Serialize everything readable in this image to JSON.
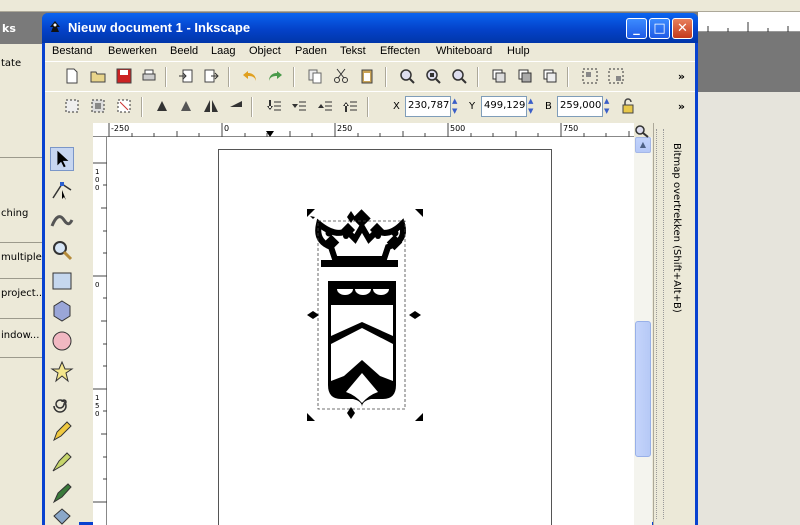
{
  "window": {
    "title": "Nieuw document 1 - Inkscape",
    "minimize_label": "_",
    "maximize_label": "□",
    "close_label": "✕"
  },
  "menu": [
    "Bestand",
    "Bewerken",
    "Beeld",
    "Laag",
    "Object",
    "Paden",
    "Tekst",
    "Effecten",
    "Whiteboard",
    "Hulp"
  ],
  "toolbar": {
    "more": "»"
  },
  "coords": {
    "x_label": "X",
    "x_value": "230,787",
    "y_label": "Y",
    "y_value": "499,129",
    "w_label": "B",
    "w_value": "259,000"
  },
  "ruler": {
    "h_ticks": [
      "-250",
      "0",
      "250",
      "500",
      "750"
    ],
    "v_ticks": [
      "1",
      "0",
      "0",
      "0",
      "1",
      "5",
      "0"
    ]
  },
  "dock": {
    "panel_title": "Bitmap overtrekken (Shift+Alt+B)"
  },
  "background_app": {
    "header": "ks",
    "items": [
      "tate",
      "ching",
      "multiple p",
      "project...",
      "indow..."
    ]
  },
  "colors": {
    "titlebar": "#0442c9",
    "window_bg": "#ece9d8",
    "canvas": "#ffffff",
    "selection_handles": "#000000"
  }
}
